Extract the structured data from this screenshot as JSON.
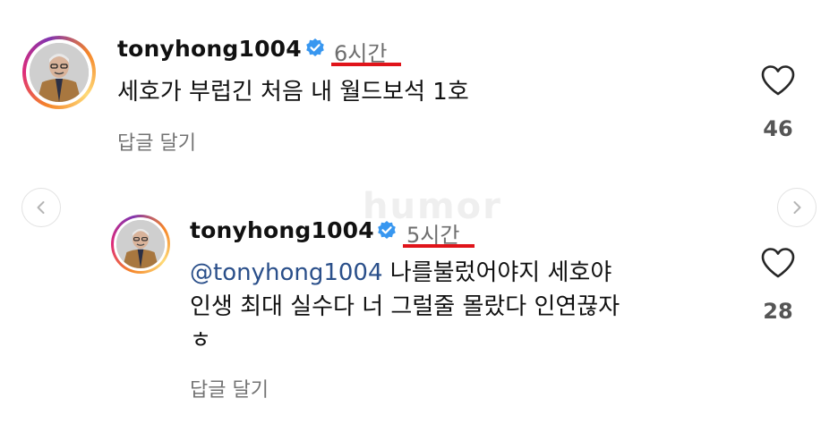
{
  "comment": {
    "username": "tonyhong1004",
    "time": "6시간",
    "text": "세호가 부럽긴 처음  내 월드보석 1호",
    "reply_link": "답글 달기",
    "likes": "46",
    "avatar_icon": "profile-photo",
    "verified_icon": "verified-badge-icon",
    "like_icon": "heart-outline-icon"
  },
  "reply": {
    "username": "tonyhong1004",
    "time": "5시간",
    "mention": "@tonyhong1004",
    "text_line1": " 나를불렀어야지 세호야",
    "text_line2": "인생 최대 실수다  너 그럴줄 몰랐다  인연끊자",
    "text_line3": "ㅎ",
    "reply_link": "답글 달기",
    "likes": "28",
    "avatar_icon": "profile-photo",
    "verified_icon": "verified-badge-icon",
    "like_icon": "heart-outline-icon"
  },
  "nav": {
    "prev_icon": "chevron-left-icon",
    "next_icon": "chevron-right-icon"
  },
  "watermark": "humor",
  "colors": {
    "verified": "#3897f0",
    "underline": "#e0141a",
    "mention": "#2a4f8a",
    "muted": "#737373"
  }
}
